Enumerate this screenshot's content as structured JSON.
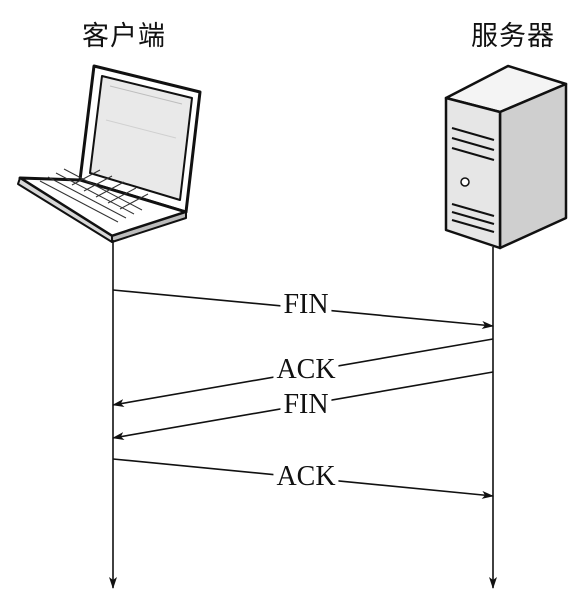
{
  "client": {
    "label": "客户端",
    "icon": "laptop-icon"
  },
  "server": {
    "label": "服务器",
    "icon": "server-tower-icon"
  },
  "messages": [
    {
      "label": "FIN",
      "direction": "client-to-server"
    },
    {
      "label": "ACK",
      "direction": "server-to-client"
    },
    {
      "label": "FIN",
      "direction": "server-to-client"
    },
    {
      "label": "ACK",
      "direction": "client-to-server"
    }
  ]
}
